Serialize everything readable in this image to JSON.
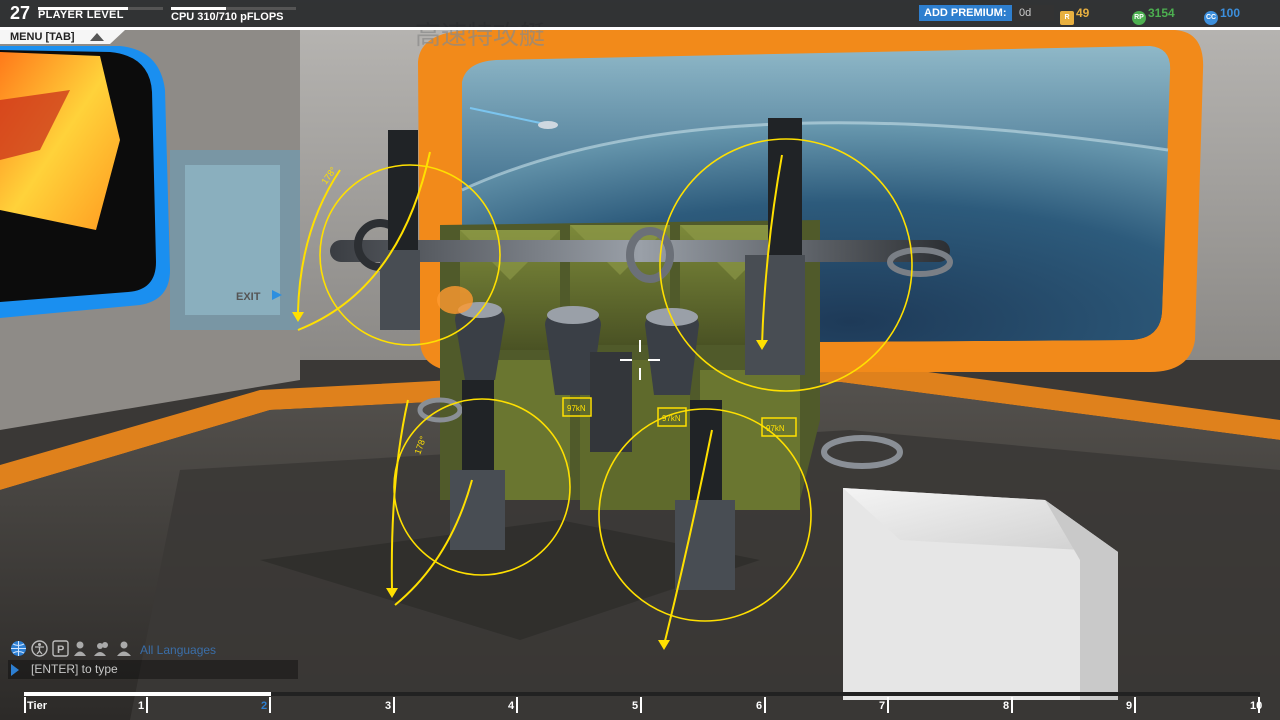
{
  "hud": {
    "player_level_number": "27",
    "player_level_label": "PLAYER LEVEL",
    "player_level_progress": 0.72,
    "cpu_label": "CPU 310/710 pFLOPS",
    "cpu_usage_fraction": 0.4366,
    "premium_label": "ADD PREMIUM:",
    "premium_days": "0d",
    "currencies": [
      {
        "icon": "robits-icon",
        "value": "49",
        "color": "#e8b040"
      },
      {
        "icon": "rp-icon",
        "value": "3154",
        "color": "#4caf50"
      },
      {
        "icon": "cc-icon",
        "value": "100",
        "color": "#3c8fdc"
      }
    ]
  },
  "menu": {
    "label": "MENU [TAB]"
  },
  "scene": {
    "background_text": "高速特攻艇",
    "exit_sign": "EXIT",
    "rotation_labels": [
      "178°",
      "178°"
    ],
    "thruster_labels": [
      "97kN",
      "97kN",
      "97kN"
    ]
  },
  "chat": {
    "language_filter": "All Languages",
    "placeholder": "[ENTER] to type",
    "icons": [
      "globe-icon",
      "accessibility-icon",
      "party-icon",
      "friend-icon",
      "group-icon",
      "clan-icon"
    ]
  },
  "tier_bar": {
    "label": "Tier",
    "ticks": [
      "1",
      "2",
      "3",
      "4",
      "5",
      "6",
      "7",
      "8",
      "9",
      "10"
    ],
    "selected": "2",
    "fill_fraction": 0.2
  },
  "colors": {
    "accent_orange": "#f28a1a",
    "hud_blue": "#2e7fcf",
    "gizmo_yellow": "#ffe000"
  }
}
